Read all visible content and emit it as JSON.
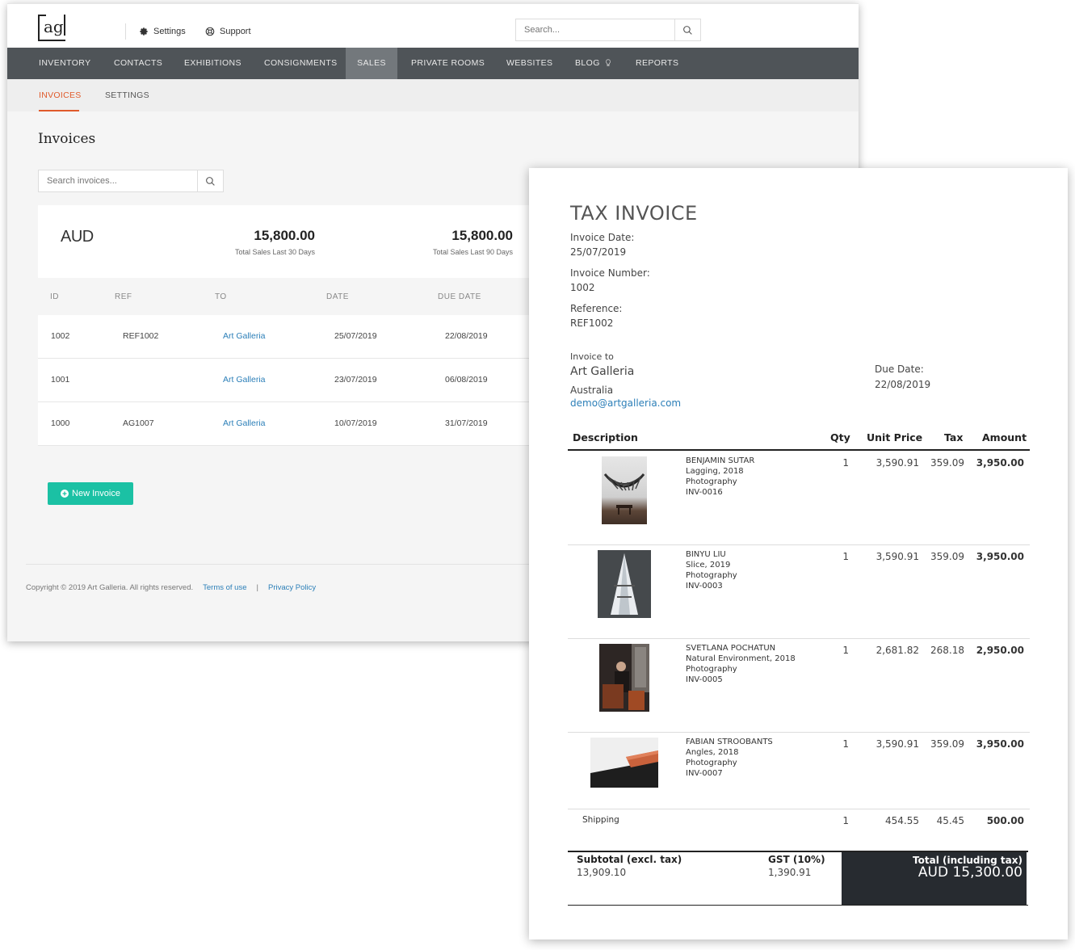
{
  "app": {
    "logo_text": "ag",
    "top_links": {
      "settings": "Settings",
      "support": "Support"
    },
    "search_placeholder": "Search...",
    "nav": [
      "INVENTORY",
      "CONTACTS",
      "EXHIBITIONS",
      "CONSIGNMENTS",
      "SALES",
      "PRIVATE ROOMS",
      "WEBSITES",
      "BLOG",
      "REPORTS"
    ],
    "nav_active": "SALES",
    "subnav": [
      "INVOICES",
      "SETTINGS"
    ],
    "subnav_active": "INVOICES",
    "page_title": "Invoices",
    "invoice_search_placeholder": "Search invoices...",
    "summary": {
      "currency": "AUD",
      "stat30_value": "15,800.00",
      "stat30_label": "Total Sales Last 30 Days",
      "stat90_value": "15,800.00",
      "stat90_label": "Total Sales Last 90 Days"
    },
    "table": {
      "headers": [
        "ID",
        "REF",
        "TO",
        "DATE",
        "DUE DATE"
      ],
      "rows": [
        {
          "id": "1002",
          "ref": "REF1002",
          "to": "Art Galleria",
          "date": "25/07/2019",
          "due": "22/08/2019"
        },
        {
          "id": "1001",
          "ref": "",
          "to": "Art Galleria",
          "date": "23/07/2019",
          "due": "06/08/2019"
        },
        {
          "id": "1000",
          "ref": "AG1007",
          "to": "Art Galleria",
          "date": "10/07/2019",
          "due": "31/07/2019"
        }
      ]
    },
    "new_invoice_label": "New Invoice",
    "footer": {
      "copyright": "Copyright © 2019 Art Galleria. All rights reserved.",
      "terms": "Terms of use",
      "separator": "|",
      "privacy": "Privacy Policy"
    }
  },
  "invoice": {
    "title": "TAX INVOICE",
    "date_label": "Invoice Date:",
    "date_value": "25/07/2019",
    "number_label": "Invoice Number:",
    "number_value": "1002",
    "reference_label": "Reference:",
    "reference_value": "REF1002",
    "invoice_to_label": "Invoice to",
    "invoice_to_name": "Art Galleria",
    "invoice_to_country": "Australia",
    "invoice_to_email": "demo@artgalleria.com",
    "due_label": "Due Date:",
    "due_value": "22/08/2019",
    "columns": {
      "description": "Description",
      "qty": "Qty",
      "unit_price": "Unit Price",
      "tax": "Tax",
      "amount": "Amount"
    },
    "items": [
      {
        "artist": "BENJAMIN SUTAR",
        "title": "Lagging, 2018",
        "medium": "Photography",
        "code": "INV-0016",
        "qty": "1",
        "unit_price": "3,590.91",
        "tax": "359.09",
        "amount": "3,950.00"
      },
      {
        "artist": "BINYU LIU",
        "title": "Slice, 2019",
        "medium": "Photography",
        "code": "INV-0003",
        "qty": "1",
        "unit_price": "3,590.91",
        "tax": "359.09",
        "amount": "3,950.00"
      },
      {
        "artist": "SVETLANA POCHATUN",
        "title": "Natural Environment, 2018",
        "medium": "Photography",
        "code": "INV-0005",
        "qty": "1",
        "unit_price": "2,681.82",
        "tax": "268.18",
        "amount": "2,950.00"
      },
      {
        "artist": "FABIAN STROOBANTS",
        "title": "Angles, 2018",
        "medium": "Photography",
        "code": "INV-0007",
        "qty": "1",
        "unit_price": "3,590.91",
        "tax": "359.09",
        "amount": "3,950.00"
      }
    ],
    "shipping": {
      "label": "Shipping",
      "qty": "1",
      "unit_price": "454.55",
      "tax": "45.45",
      "amount": "500.00"
    },
    "totals": {
      "subtotal_label": "Subtotal (excl. tax)",
      "subtotal_value": "13,909.10",
      "gst_label": "GST (10%)",
      "gst_value": "1,390.91",
      "total_label": "Total (including tax)",
      "total_value": "AUD 15,300.00"
    }
  },
  "colors": {
    "nav_bg": "#4f5458",
    "nav_active": "#73787c",
    "accent": "#e05a2b",
    "link": "#2c7fb8",
    "button": "#1bc1a4",
    "total_box": "#272b30"
  },
  "icons": [
    "gear-icon",
    "support-icon",
    "search-icon",
    "lightbulb-icon",
    "plus-circle-icon"
  ]
}
